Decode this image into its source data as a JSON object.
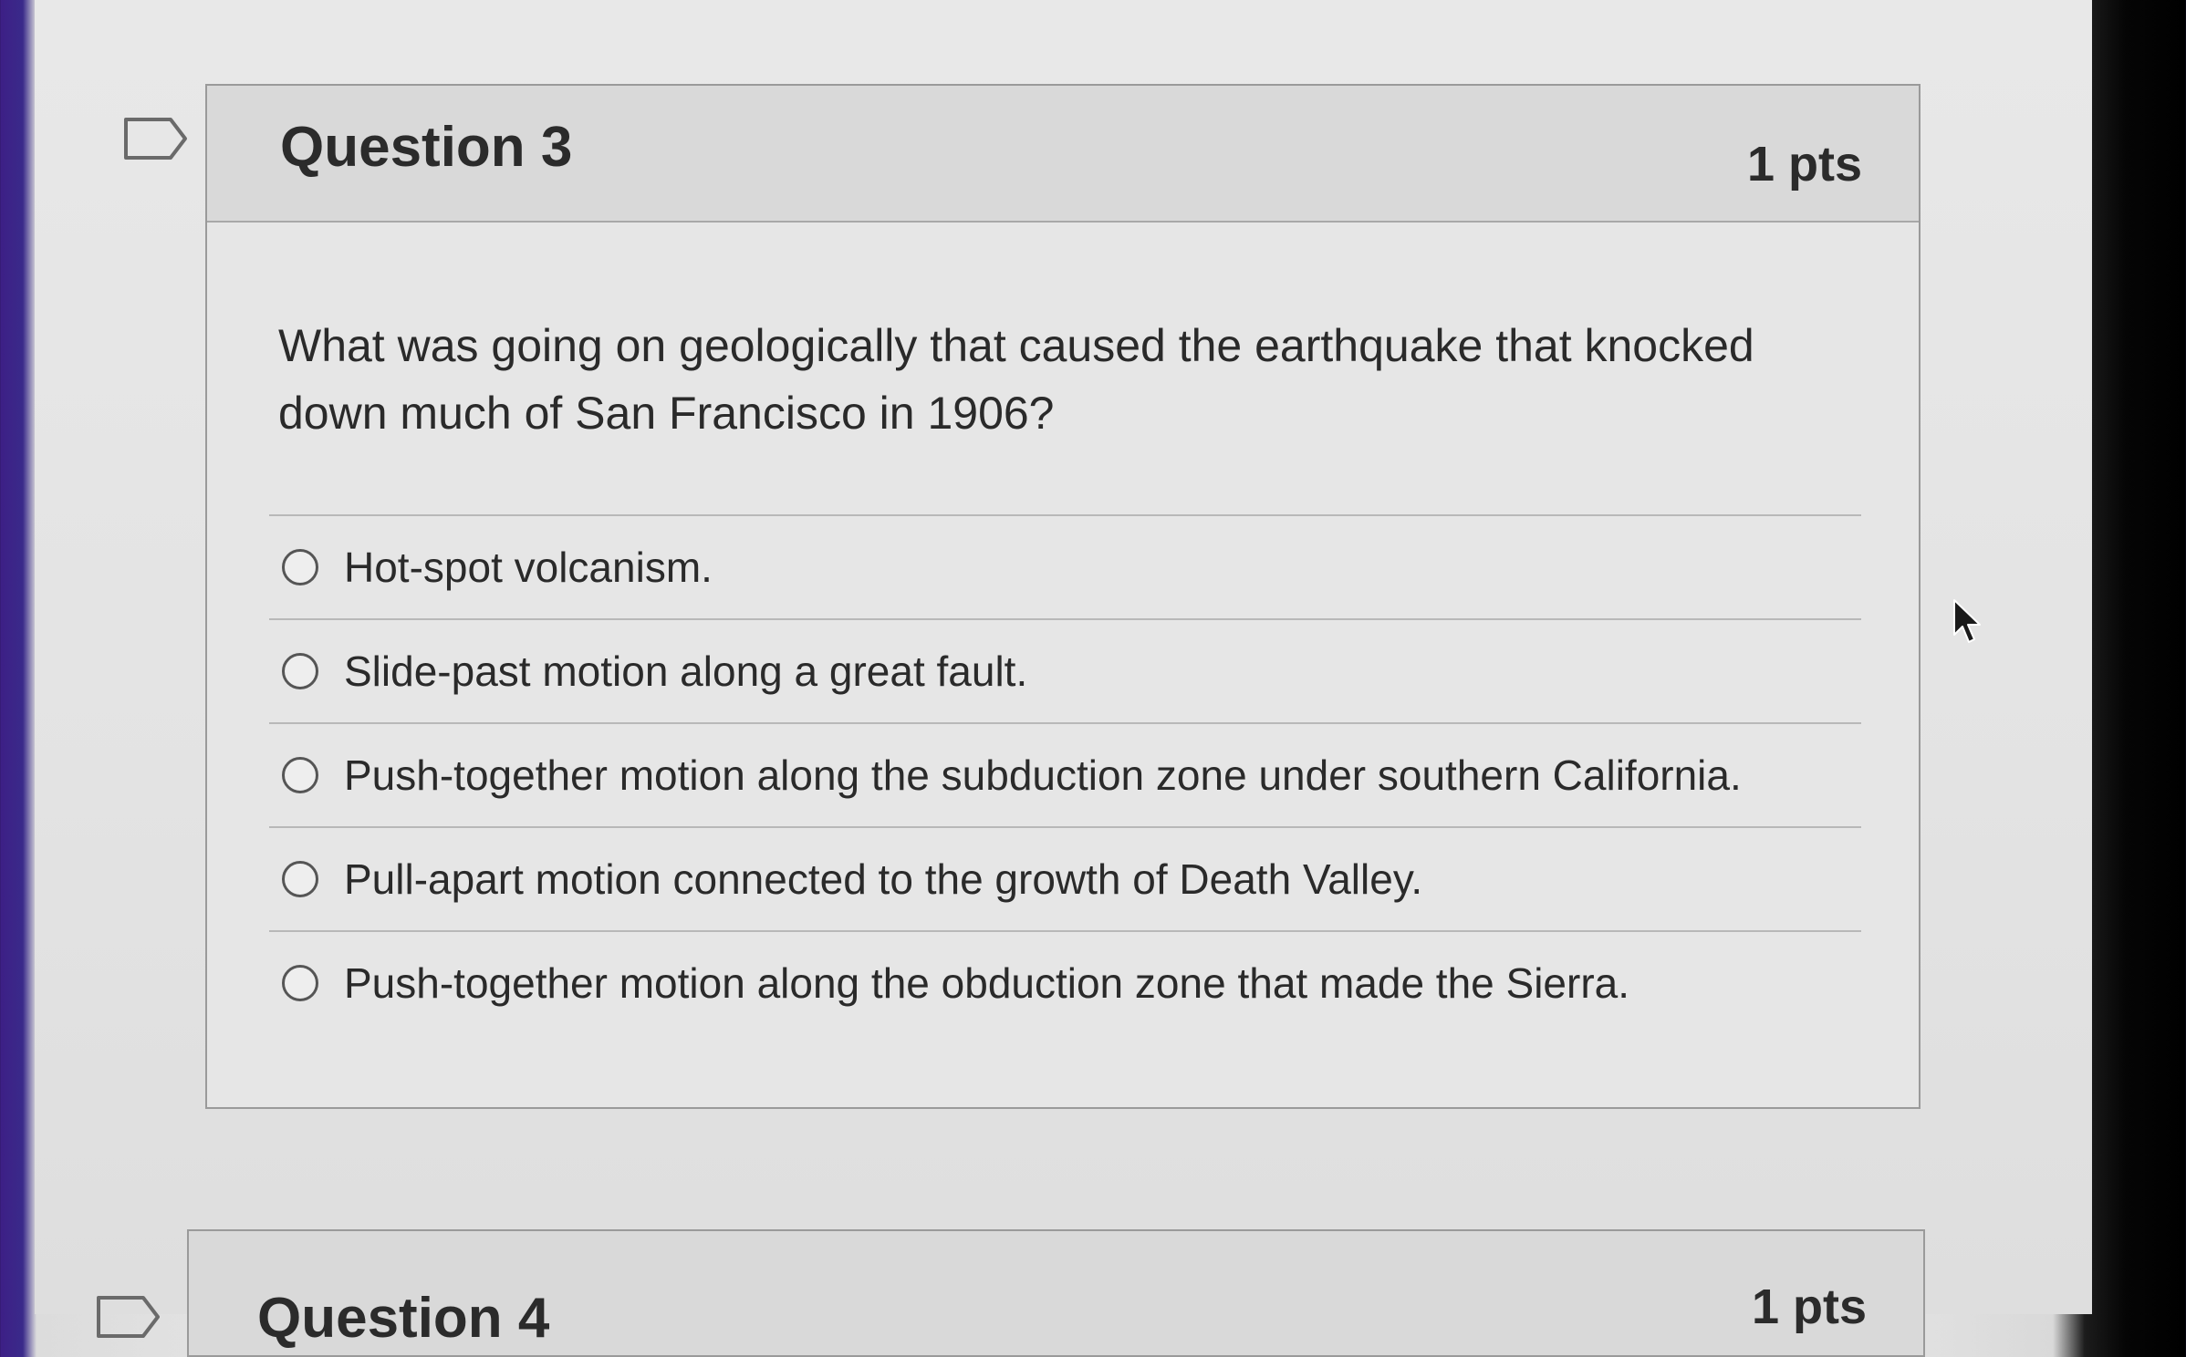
{
  "question": {
    "title": "Question 3",
    "points": "1 pts",
    "text": "What was going on geologically that caused the earthquake that knocked down much of San Francisco in 1906?",
    "answers": [
      {
        "label": "Hot-spot volcanism.",
        "selected": false
      },
      {
        "label": "Slide-past motion along a great fault.",
        "selected": false
      },
      {
        "label": "Push-together motion along the subduction zone under southern California.",
        "selected": false
      },
      {
        "label": "Pull-apart motion connected to the growth of Death Valley.",
        "selected": false
      },
      {
        "label": "Push-together motion along the obduction zone that made the Sierra.",
        "selected": false
      }
    ]
  },
  "next_question": {
    "title": "Question 4",
    "points": "1 pts"
  },
  "icons": {
    "flag": "flag-icon",
    "cursor": "mouse-pointer-icon"
  },
  "colors": {
    "header_bg": "#d9d9d9",
    "card_bg": "#e6e6e6",
    "text": "#2a2a2a",
    "border": "#9a9a9a"
  }
}
